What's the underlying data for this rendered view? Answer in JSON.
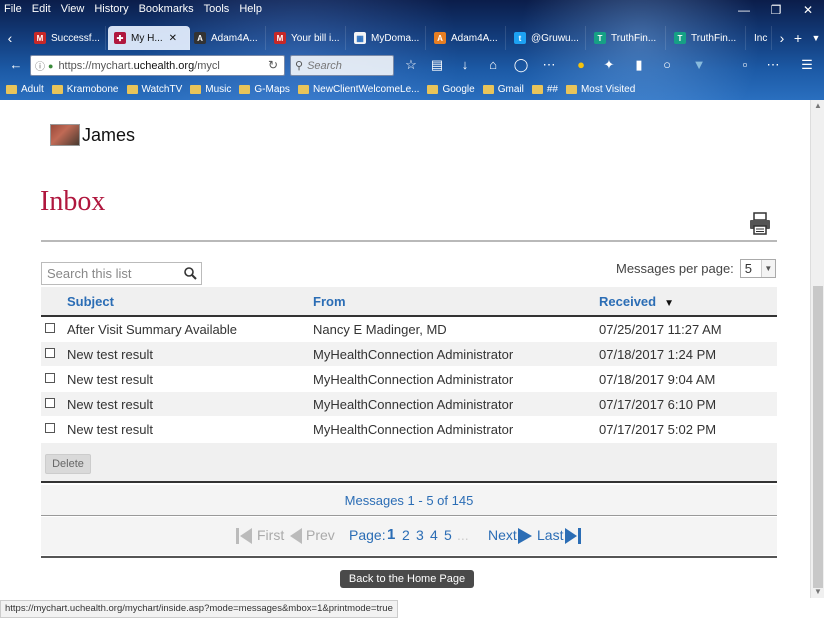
{
  "browser": {
    "menu": [
      "File",
      "Edit",
      "View",
      "History",
      "Bookmarks",
      "Tools",
      "Help"
    ],
    "tabs": [
      {
        "label": "Successf...",
        "icon": "gmail-icon",
        "color": "#c62828",
        "glyph": "M"
      },
      {
        "label": "My H...",
        "icon": "mychart-icon",
        "color": "#b0173e",
        "glyph": "✚",
        "close": "✕"
      },
      {
        "label": "Adam4A...",
        "icon": "adam4adam-icon",
        "color": "#333333",
        "glyph": "A"
      },
      {
        "label": "Your bill i...",
        "icon": "gmail-icon",
        "color": "#c62828",
        "glyph": "M"
      },
      {
        "label": "MyDoma...",
        "icon": "mydomain-icon",
        "color": "#f5f5f5",
        "glyph": "▦"
      },
      {
        "label": "Adam4A...",
        "icon": "adam4adam-icon",
        "color": "#e67e22",
        "glyph": "A"
      },
      {
        "label": "@Gruwu...",
        "icon": "twitter-icon",
        "color": "#1da1f2",
        "glyph": "t"
      },
      {
        "label": "TruthFin...",
        "icon": "truthfinder-icon",
        "color": "#16a085",
        "glyph": "T"
      },
      {
        "label": "TruthFin...",
        "icon": "truthfinder-icon",
        "color": "#16a085",
        "glyph": "T"
      },
      {
        "label": "Inc",
        "icon": "tab-overflow-icon",
        "color": "#888888",
        "glyph": ""
      }
    ],
    "url_prefix": "https://mychart.",
    "url_host": "uchealth.org",
    "url_suffix": "/mycl",
    "search_placeholder": "Search",
    "bookmarks": [
      "Adult",
      "Kramobone",
      "WatchTV",
      "Music",
      "G-Maps",
      "NewClientWelcomeLe...",
      "Google",
      "Gmail",
      "##",
      "Most Visited"
    ],
    "status_url": "https://mychart.uchealth.org/mychart/inside.asp?mode=messages&mbox=1&printmode=true"
  },
  "page": {
    "user_name": "James",
    "title": "Inbox",
    "search_placeholder": "Search this list",
    "per_page_label": "Messages per page:",
    "per_page_value": "5",
    "columns": {
      "subject": "Subject",
      "from": "From",
      "received": "Received",
      "sort_indicator": "▼"
    },
    "messages": [
      {
        "subject": "After Visit Summary Available",
        "from": "Nancy E Madinger, MD",
        "received": "07/25/2017 11:27 AM"
      },
      {
        "subject": "New test result",
        "from": "MyHealthConnection Administrator",
        "received": "07/18/2017 1:24 PM"
      },
      {
        "subject": "New test result",
        "from": "MyHealthConnection Administrator",
        "received": "07/18/2017 9:04 AM"
      },
      {
        "subject": "New test result",
        "from": "MyHealthConnection Administrator",
        "received": "07/17/2017 6:10 PM"
      },
      {
        "subject": "New test result",
        "from": "MyHealthConnection Administrator",
        "received": "07/17/2017 5:02 PM"
      }
    ],
    "delete_label": "Delete",
    "count_text": "Messages 1 - 5 of 145",
    "pager": {
      "first": "First",
      "prev": "Prev",
      "page_label": "Page:",
      "current": "1",
      "pages": [
        "2",
        "3",
        "4",
        "5"
      ],
      "ellipsis": "...",
      "next": "Next",
      "last": "Last"
    },
    "home_button": "Back to the Home Page"
  }
}
